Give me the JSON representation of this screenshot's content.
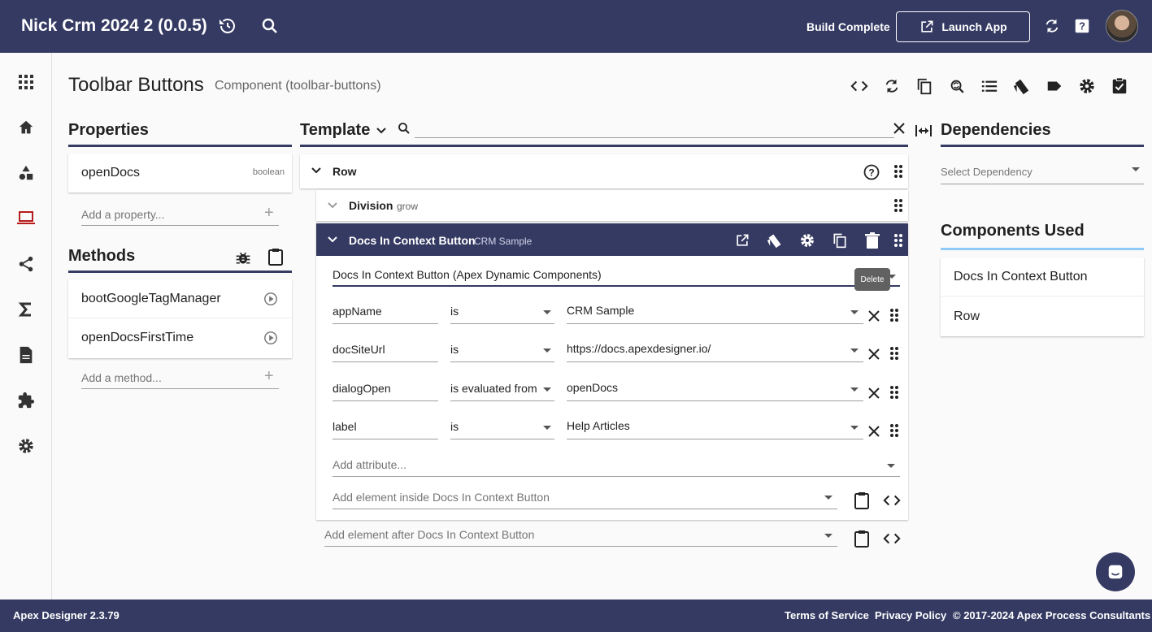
{
  "topbar": {
    "title": "Nick Crm 2024 2 (0.0.5)",
    "status": "Build Complete",
    "launch_label": "Launch App"
  },
  "page": {
    "title": "Toolbar Buttons",
    "subtitle": "Component (toolbar-buttons)"
  },
  "properties": {
    "heading": "Properties",
    "items": [
      {
        "name": "openDocs",
        "type": "boolean"
      }
    ],
    "add_placeholder": "Add a property..."
  },
  "methods": {
    "heading": "Methods",
    "items": [
      {
        "name": "bootGoogleTagManager"
      },
      {
        "name": "openDocsFirstTime"
      }
    ],
    "add_placeholder": "Add a method..."
  },
  "template": {
    "heading": "Template",
    "search_value": "",
    "row": {
      "label": "Row"
    },
    "division": {
      "label": "Division",
      "tag": "grow"
    },
    "selected": {
      "label": "Docs In Context Button",
      "tag": "CRM Sample",
      "component_select": "Docs In Context Button (Apex Dynamic Components)"
    },
    "tooltip": "Delete",
    "attributes": [
      {
        "name": "appName",
        "operator": "is",
        "value": "CRM Sample"
      },
      {
        "name": "docSiteUrl",
        "operator": "is",
        "value": "https://docs.apexdesigner.io/"
      },
      {
        "name": "dialogOpen",
        "operator": "is evaluated from",
        "value": "openDocs"
      },
      {
        "name": "label",
        "operator": "is",
        "value": "Help Articles"
      }
    ],
    "add_attribute": "Add attribute...",
    "add_inside": "Add element inside Docs In Context Button",
    "add_after": "Add element after Docs In Context Button"
  },
  "dependencies": {
    "heading": "Dependencies",
    "select_placeholder": "Select Dependency"
  },
  "components_used": {
    "heading": "Components Used",
    "items": [
      "Docs In Context Button",
      "Row"
    ]
  },
  "footer": {
    "version": "Apex Designer 2.3.79",
    "terms": "Terms of Service",
    "privacy": "Privacy Policy",
    "copyright": "© 2017-2024 Apex Process Consultants"
  },
  "colors": {
    "primary": "#353a63",
    "accent": "#90caf9",
    "background": "#fafafa"
  }
}
